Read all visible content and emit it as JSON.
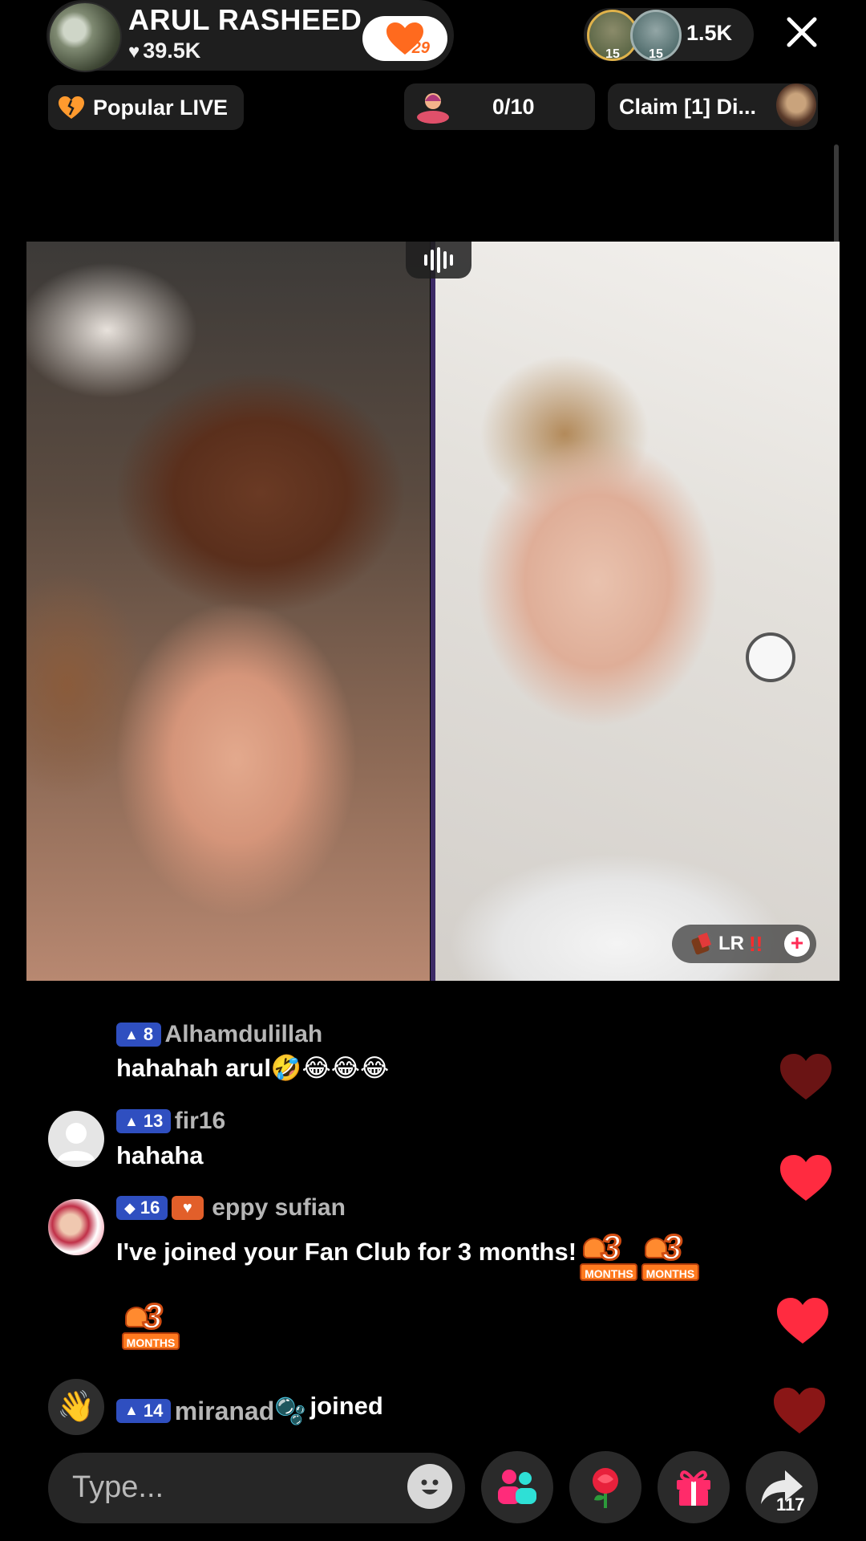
{
  "header": {
    "host_name": "ARUL RASHEED",
    "host_likes": "39.5K",
    "fan_club_level": "29",
    "viewer_badges": [
      "15",
      "15"
    ],
    "viewer_count": "1.5K"
  },
  "subbar": {
    "popular_label": "Popular LIVE",
    "goal_progress": "0/10",
    "claim_label": "Claim [1] Di..."
  },
  "guest": {
    "tag_label": "LR",
    "tag_emphasis": "!!"
  },
  "chat": [
    {
      "level": "8",
      "username": "Alhamdulillah",
      "message": "hahahah arul🤣😂😂😂"
    },
    {
      "level": "13",
      "username": "fir16",
      "message": "hahaha"
    },
    {
      "level": "16",
      "username": "eppy sufian",
      "message": "I've joined your Fan Club for 3 months!"
    },
    {
      "level": "14",
      "username": "miranad🫧",
      "message": "joined"
    }
  ],
  "stickers": {
    "number": "3",
    "label": "MONTHS"
  },
  "input": {
    "placeholder": "Type..."
  },
  "share_count": "117",
  "colors": {
    "accent_red": "#ff2b40",
    "level_badge": "#2f4fc0",
    "fan_orange": "#ff6a1e"
  }
}
